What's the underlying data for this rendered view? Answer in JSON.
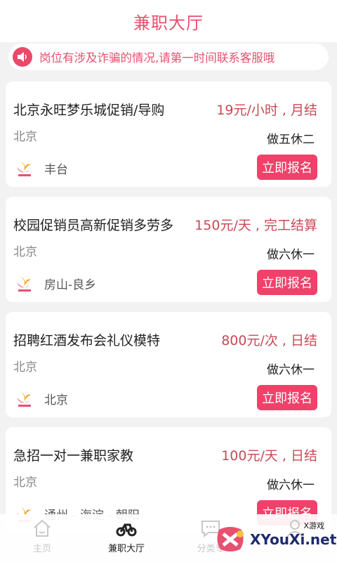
{
  "header": {
    "title": "兼职大厅"
  },
  "notice": {
    "text": "岗位有涉及诈骗的情况,请第一时间联系客服哦",
    "icon": "speaker-icon"
  },
  "jobs": [
    {
      "title": "北京永旺梦乐城促销/导购",
      "salary": "19元/小时 , 月结",
      "city": "北京",
      "schedule": "做五休二",
      "district": "丰台",
      "apply_label": "立即报名"
    },
    {
      "title": "校园促销员高新促销多劳多",
      "salary": "150元/天 , 完工结算",
      "city": "北京",
      "schedule": "做六休一",
      "district": "房山-良乡",
      "apply_label": "立即报名"
    },
    {
      "title": "招聘红酒发布会礼仪模特",
      "salary": "800元/次 , 日结",
      "city": "北京",
      "schedule": "做六休一",
      "district": "北京",
      "apply_label": "立即报名"
    },
    {
      "title": "急招一对一兼职家教",
      "salary": "100元/天 , 日结",
      "city": "北京",
      "schedule": "做六休一",
      "district": "通州 - 海淀 - 朝阳",
      "apply_label": "立即报名"
    }
  ],
  "tabbar": {
    "items": [
      {
        "label": "主页",
        "icon": "home-icon"
      },
      {
        "label": "兼职大厅",
        "icon": "bicycle-icon",
        "active": true
      },
      {
        "label": "分类专",
        "icon": "chat-icon"
      },
      {
        "label": "",
        "icon": "profile-icon"
      }
    ]
  },
  "watermark": {
    "text": "XYouXi.net",
    "small": "X游戏"
  },
  "colors": {
    "accent": "#e8506f",
    "button": "#f0416a",
    "salary": "#c74a55"
  }
}
